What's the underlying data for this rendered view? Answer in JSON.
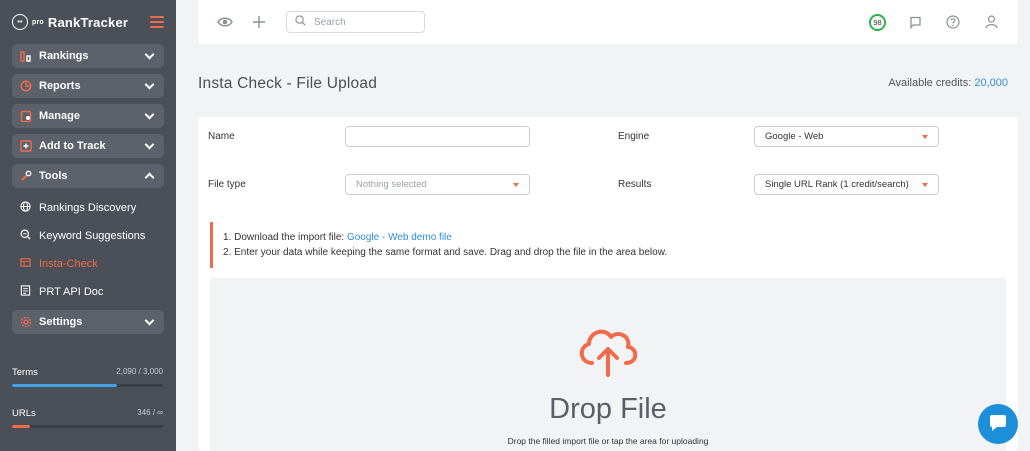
{
  "brand": {
    "name": "RankTracker",
    "prefix": "pro"
  },
  "sidebar": {
    "groups": [
      {
        "label": "Rankings",
        "icon": "bar-chart-icon"
      },
      {
        "label": "Reports",
        "icon": "pie-chart-icon"
      },
      {
        "label": "Manage",
        "icon": "clipboard-icon"
      },
      {
        "label": "Add to Track",
        "icon": "plus-box-icon"
      },
      {
        "label": "Tools",
        "icon": "tools-icon"
      }
    ],
    "tools_items": [
      {
        "label": "Rankings Discovery",
        "icon": "globe-icon"
      },
      {
        "label": "Keyword Suggestions",
        "icon": "magnifier-icon"
      },
      {
        "label": "Insta-Check",
        "icon": "table-icon",
        "active": true
      },
      {
        "label": "PRT API Doc",
        "icon": "document-icon"
      }
    ],
    "settings_label": "Settings",
    "quotas": [
      {
        "label": "Terms",
        "value": "2,090 / 3,000",
        "fraction": 0.6967,
        "color": "#3ea3e8"
      },
      {
        "label": "URLs",
        "value": "346 / ∞",
        "fraction": 0.12,
        "color": "#f06b4a"
      }
    ]
  },
  "topbar": {
    "search_placeholder": "Search",
    "score": "98"
  },
  "page": {
    "title": "Insta Check - File Upload",
    "credits_label": "Available credits:",
    "credits_value": "20,000"
  },
  "form": {
    "name_label": "Name",
    "name_value": "",
    "engine_label": "Engine",
    "engine_value": "Google - Web",
    "file_type_label": "File type",
    "file_type_placeholder": "Nothing selected",
    "results_label": "Results",
    "results_value": "Single URL Rank (1 credit/search)"
  },
  "instructions": {
    "line1_prefix": "1. Download the import file: ",
    "line1_link": "Google - Web demo file",
    "line2": "2. Enter your data while keeping the same format and save. Drag and drop the file in the area below."
  },
  "dropzone": {
    "title": "Drop File",
    "subtitle": "Drop the filled import file or tap the area for uploading"
  },
  "colors": {
    "accent": "#f06b4a",
    "link": "#2f8fdc",
    "sidebar_bg": "#4b5058",
    "score_ring": "#2bb24c"
  }
}
